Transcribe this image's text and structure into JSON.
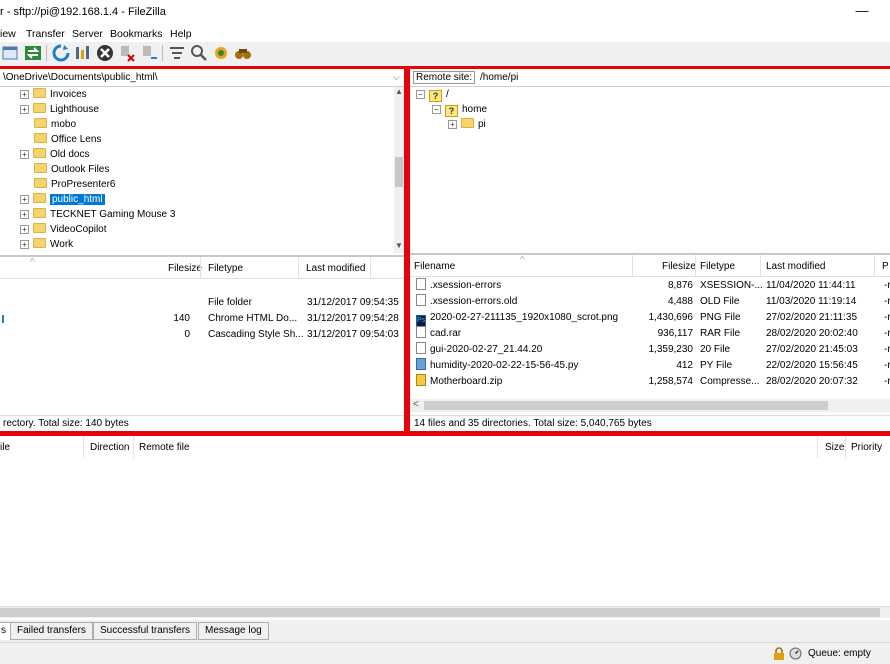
{
  "window": {
    "title": "r - sftp://pi@192.168.1.4 - FileZilla",
    "minimize": "—"
  },
  "menu": [
    "iew",
    "Transfer",
    "Server",
    "Bookmarks",
    "Help"
  ],
  "toolbar_icons": [
    "site-manager-icon",
    "sync-icon",
    "refresh-icon",
    "process-queue-icon",
    "cancel-icon",
    "disconnect-icon",
    "reconnect-icon",
    "filter-icon",
    "compare-icon",
    "sync-browse-icon",
    "find-icon"
  ],
  "local": {
    "path": "\\OneDrive\\Documents\\public_html\\",
    "tree": [
      {
        "label": "Invoices",
        "expander": "+"
      },
      {
        "label": "Lighthouse",
        "expander": "+"
      },
      {
        "label": "mobo",
        "expander": ""
      },
      {
        "label": "Office Lens",
        "expander": ""
      },
      {
        "label": "Old docs",
        "expander": "+"
      },
      {
        "label": "Outlook Files",
        "expander": ""
      },
      {
        "label": "ProPresenter6",
        "expander": ""
      },
      {
        "label": "public_html",
        "expander": "+",
        "selected": true
      },
      {
        "label": "TECKNET Gaming Mouse 3",
        "expander": "+"
      },
      {
        "label": "VideoCopilot",
        "expander": "+"
      },
      {
        "label": "Work",
        "expander": "+"
      }
    ],
    "columns": {
      "filesize": "Filesize",
      "filetype": "Filetype",
      "modified": "Last modified"
    },
    "files": [
      {
        "size": "",
        "type": "File folder",
        "modified": "31/12/2017 09:54:35"
      },
      {
        "size": "140",
        "type": "Chrome HTML Do...",
        "modified": "31/12/2017 09:54:28"
      },
      {
        "size": "0",
        "type": "Cascading Style Sh...",
        "modified": "31/12/2017 09:54:03"
      }
    ],
    "status": "rectory. Total size: 140 bytes"
  },
  "remote": {
    "site_label": "Remote site:",
    "path": "/home/pi",
    "tree": [
      {
        "label": "/",
        "expander": "−",
        "indent": 0
      },
      {
        "label": "home",
        "expander": "−",
        "indent": 1
      },
      {
        "label": "pi",
        "expander": "+",
        "indent": 2
      }
    ],
    "columns": {
      "filename": "Filename",
      "filesize": "Filesize",
      "filetype": "Filetype",
      "modified": "Last modified",
      "perm": "P"
    },
    "files": [
      {
        "name": ".xsession-errors",
        "size": "8,876",
        "type": "XSESSION-...",
        "modified": "11/04/2020 11:44:11",
        "perm": "-r",
        "icon": "file-icon"
      },
      {
        "name": ".xsession-errors.old",
        "size": "4,488",
        "type": "OLD File",
        "modified": "11/03/2020 11:19:14",
        "perm": "-r",
        "icon": "file-icon"
      },
      {
        "name": "2020-02-27-211135_1920x1080_scrot.png",
        "size": "1,430,696",
        "type": "PNG File",
        "modified": "27/02/2020 21:11:35",
        "perm": "-r",
        "icon": "photoshop-file-icon"
      },
      {
        "name": "cad.rar",
        "size": "936,117",
        "type": "RAR File",
        "modified": "28/02/2020 20:02:40",
        "perm": "-r",
        "icon": "file-icon"
      },
      {
        "name": "gui-2020-02-27_21.44.20",
        "size": "1,359,230",
        "type": "20 File",
        "modified": "27/02/2020 21:45:03",
        "perm": "-r",
        "icon": "file-icon"
      },
      {
        "name": "humidity-2020-02-22-15-56-45.py",
        "size": "412",
        "type": "PY File",
        "modified": "22/02/2020 15:56:45",
        "perm": "-r",
        "icon": "python-file-icon"
      },
      {
        "name": "Motherboard.zip",
        "size": "1,258,574",
        "type": "Compresse...",
        "modified": "28/02/2020 20:07:32",
        "perm": "-r",
        "icon": "zip-file-icon"
      }
    ],
    "status": "14 files and 35 directories. Total size: 5,040,765 bytes"
  },
  "queue": {
    "columns": {
      "local": "ile",
      "direction": "Direction",
      "remote": "Remote file",
      "size": "Size",
      "priority": "Priority"
    }
  },
  "tabs": [
    {
      "label": "s",
      "active": true
    },
    {
      "label": "Failed transfers",
      "active": false
    },
    {
      "label": "Successful transfers",
      "active": false
    },
    {
      "label": "Message log",
      "active": false
    }
  ],
  "statusbar": {
    "queue": "Queue: empty"
  },
  "colors": {
    "highlight_border": "#e8000a",
    "selection": "#0078d7"
  }
}
